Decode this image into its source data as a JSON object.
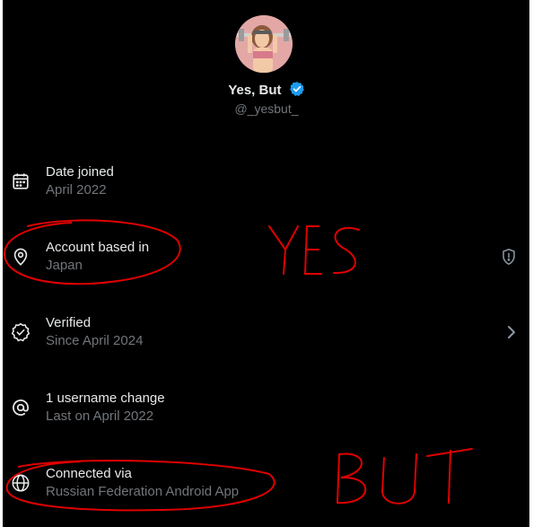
{
  "profile": {
    "name": "Yes, But",
    "handle": "@_yesbut_"
  },
  "rows": [
    {
      "title": "Date joined",
      "sub": "April 2022",
      "icon": "calendar-icon"
    },
    {
      "title": "Account based in",
      "sub": "Japan",
      "icon": "location-pin-icon",
      "right_icon": "shield-alert-icon"
    },
    {
      "title": "Verified",
      "sub": "Since April 2024",
      "icon": "verified-check-icon",
      "right_icon": "chevron-right-icon"
    },
    {
      "title": "1 username change",
      "sub": "Last on April 2022",
      "icon": "at-sign-icon"
    },
    {
      "title": "Connected via",
      "sub": "Russian Federation Android App",
      "icon": "globe-icon"
    }
  ],
  "annotations": {
    "yes": "YES",
    "but": "BUT",
    "color": "#e00000"
  },
  "colors": {
    "background": "#000000",
    "primary_text": "#e7e9ea",
    "secondary_text": "#71767b",
    "verified_badge": "#1d9bf0"
  }
}
